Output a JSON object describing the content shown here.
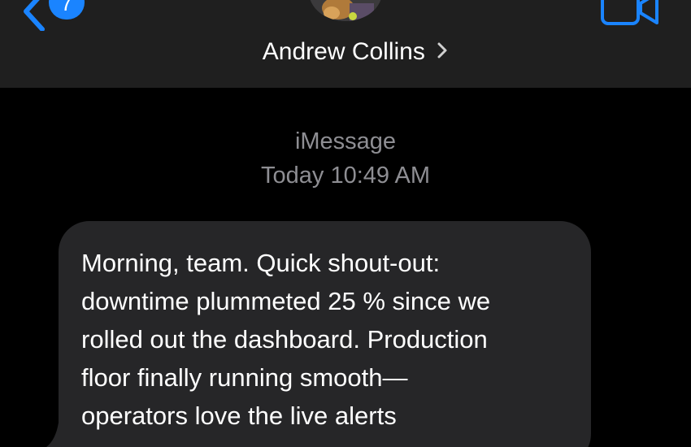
{
  "header": {
    "back_badge_count": "7",
    "contact_name": "Andrew Collins",
    "accent_color": "#1a84ff"
  },
  "conversation": {
    "service_label": "iMessage",
    "timestamp": "Today 10:49 AM"
  },
  "messages": [
    {
      "direction": "incoming",
      "lines": [
        "Morning, team. Quick shout-out:",
        "downtime plummeted 25 % since we",
        "rolled out the dashboard. Production",
        "floor finally running smooth—",
        "operators love the live alerts"
      ]
    }
  ],
  "icons": {
    "back": "chevron-left-icon",
    "video": "video-camera-icon",
    "contact_detail": "chevron-right-icon"
  }
}
